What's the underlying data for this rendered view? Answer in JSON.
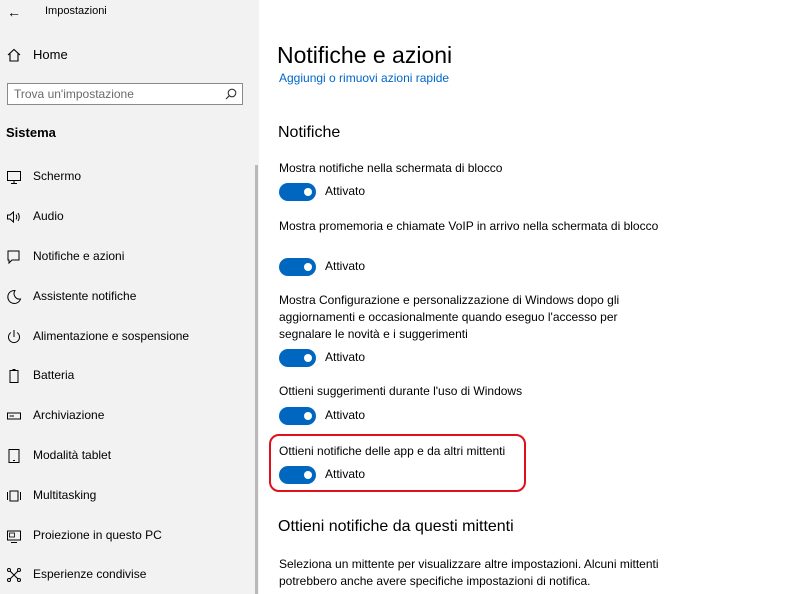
{
  "window": {
    "title": "Impostazioni"
  },
  "sidebar": {
    "home_label": "Home",
    "search_placeholder": "Trova un'impostazione",
    "section_title": "Sistema",
    "items": [
      {
        "label": "Schermo",
        "icon": "monitor-icon"
      },
      {
        "label": "Audio",
        "icon": "speaker-icon"
      },
      {
        "label": "Notifiche e azioni",
        "icon": "notification-icon"
      },
      {
        "label": "Assistente notifiche",
        "icon": "moon-icon"
      },
      {
        "label": "Alimentazione e sospensione",
        "icon": "power-icon"
      },
      {
        "label": "Batteria",
        "icon": "battery-icon"
      },
      {
        "label": "Archiviazione",
        "icon": "storage-icon"
      },
      {
        "label": "Modalità tablet",
        "icon": "tablet-icon"
      },
      {
        "label": "Multitasking",
        "icon": "multitasking-icon"
      },
      {
        "label": "Proiezione in questo PC",
        "icon": "projection-icon"
      },
      {
        "label": "Esperienze condivise",
        "icon": "shared-icon"
      }
    ]
  },
  "main": {
    "title": "Notifiche e azioni",
    "quick_actions_link": "Aggiungi o rimuovi azioni rapide",
    "notifications_heading": "Notifiche",
    "settings": [
      {
        "label": "Mostra notifiche nella schermata di blocco",
        "state": "Attivato"
      },
      {
        "label": "Mostra promemoria e chiamate VoIP in arrivo nella schermata di blocco",
        "state": "Attivato"
      },
      {
        "label": "Mostra Configurazione e personalizzazione di Windows dopo gli aggiornamenti e occasionalmente quando eseguo l'accesso per segnalare le novità e i suggerimenti",
        "state": "Attivato"
      },
      {
        "label": "Ottieni suggerimenti durante l'uso di Windows",
        "state": "Attivato"
      },
      {
        "label": "Ottieni notifiche delle app e da altri mittenti",
        "state": "Attivato"
      }
    ],
    "senders_heading": "Ottieni notifiche da questi mittenti",
    "senders_description": "Seleziona un mittente per visualizzare altre impostazioni. Alcuni mittenti potrebbero anche avere specifiche impostazioni di notifica."
  },
  "colors": {
    "accent": "#0067c0",
    "highlight": "#e0101a",
    "link": "#0066cc",
    "sidebar_bg": "#f2f2f2"
  }
}
